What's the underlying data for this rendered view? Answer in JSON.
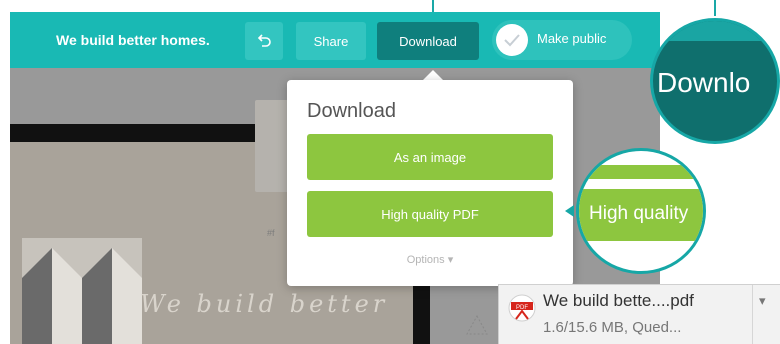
{
  "header": {
    "brand": "We build better homes.",
    "undo_icon": "undo-icon",
    "share_label": "Share",
    "download_label": "Download",
    "make_public_label": "Make public",
    "check_icon": "check-icon"
  },
  "canvas": {
    "tag": "#f",
    "script_text": "We build better"
  },
  "download_popup": {
    "title": "Download",
    "as_image": "As an image",
    "pdf": "High quality PDF",
    "options": "Options ▾"
  },
  "zoom": {
    "download_text": "Downlo",
    "pdf_text": "High quality"
  },
  "download_bar": {
    "file_name": "We build  bette....pdf",
    "status": "1.6/15.6 MB, Qued...",
    "menu_icon": "chevron-down-icon",
    "file_icon": "pdf-icon"
  },
  "colors": {
    "teal": "#19b9b4",
    "teal_dark": "#0f7f7d",
    "green": "#8dc63f"
  }
}
